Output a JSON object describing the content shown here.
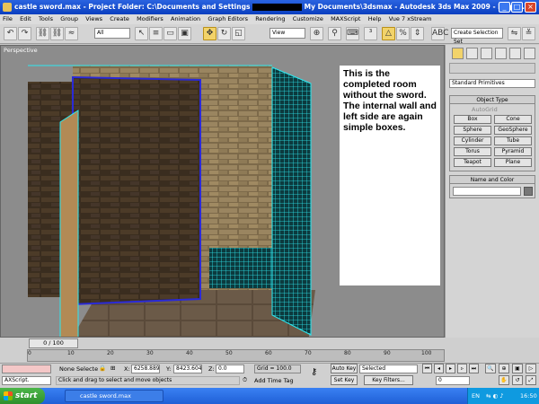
{
  "titlebar": {
    "title_left": "castle sword.max",
    "title_mid": "- Project Folder: C:\\Documents and Settings",
    "title_right": "My Documents\\3dsmax    - Autodesk 3ds Max  2009    - Displ..."
  },
  "menu": [
    "File",
    "Edit",
    "Tools",
    "Group",
    "Views",
    "Create",
    "Modifiers",
    "Animation",
    "Graph Editors",
    "Rendering",
    "Customize",
    "MAXScript",
    "Help",
    "Vue 7 xStream"
  ],
  "toolbar": {
    "selection_filter": "All",
    "ref_coord": "View",
    "named_selection": "Create Selection Set"
  },
  "viewport": {
    "label": "Perspective",
    "note": "This is the completed room without the sword. The internal wall and left side are again simple boxes."
  },
  "command_panel": {
    "dropdown": "Standard Primitives",
    "object_type_header": "Object Type",
    "autogrid": "AutoGrid",
    "buttons": [
      "Box",
      "Cone",
      "Sphere",
      "GeoSphere",
      "Cylinder",
      "Tube",
      "Torus",
      "Pyramid",
      "Teapot",
      "Plane"
    ],
    "name_color_header": "Name and Color"
  },
  "timeline": {
    "slider": "0 / 100",
    "ticks": [
      "0",
      "10",
      "20",
      "30",
      "40",
      "50",
      "60",
      "70",
      "80",
      "90",
      "100"
    ]
  },
  "status": {
    "selection": "None Selecte",
    "x_label": "X:",
    "x_value": "6258.889",
    "y_label": "Y:",
    "y_value": "8423.604",
    "z_label": "Z:",
    "z_value": "0.0",
    "grid": "Grid = 100.0",
    "auto_key": "Auto Key",
    "key_mode": "Selected",
    "set_key": "Set Key",
    "key_filters": "Key Filters...",
    "frame": "0",
    "maxscript": "AXScript.",
    "prompt": "Click and drag to select and move objects",
    "add_time_tag": "Add Time Tag"
  },
  "taskbar": {
    "start": "start",
    "task": "castle sword.max",
    "lang": "EN",
    "clock": "16:50"
  },
  "colors": {
    "title_blue": "#0a3fc0",
    "selection_cyan": "#2ee8f0",
    "selection_blue": "#2a2ad8",
    "xp_green": "#3ca33a"
  }
}
